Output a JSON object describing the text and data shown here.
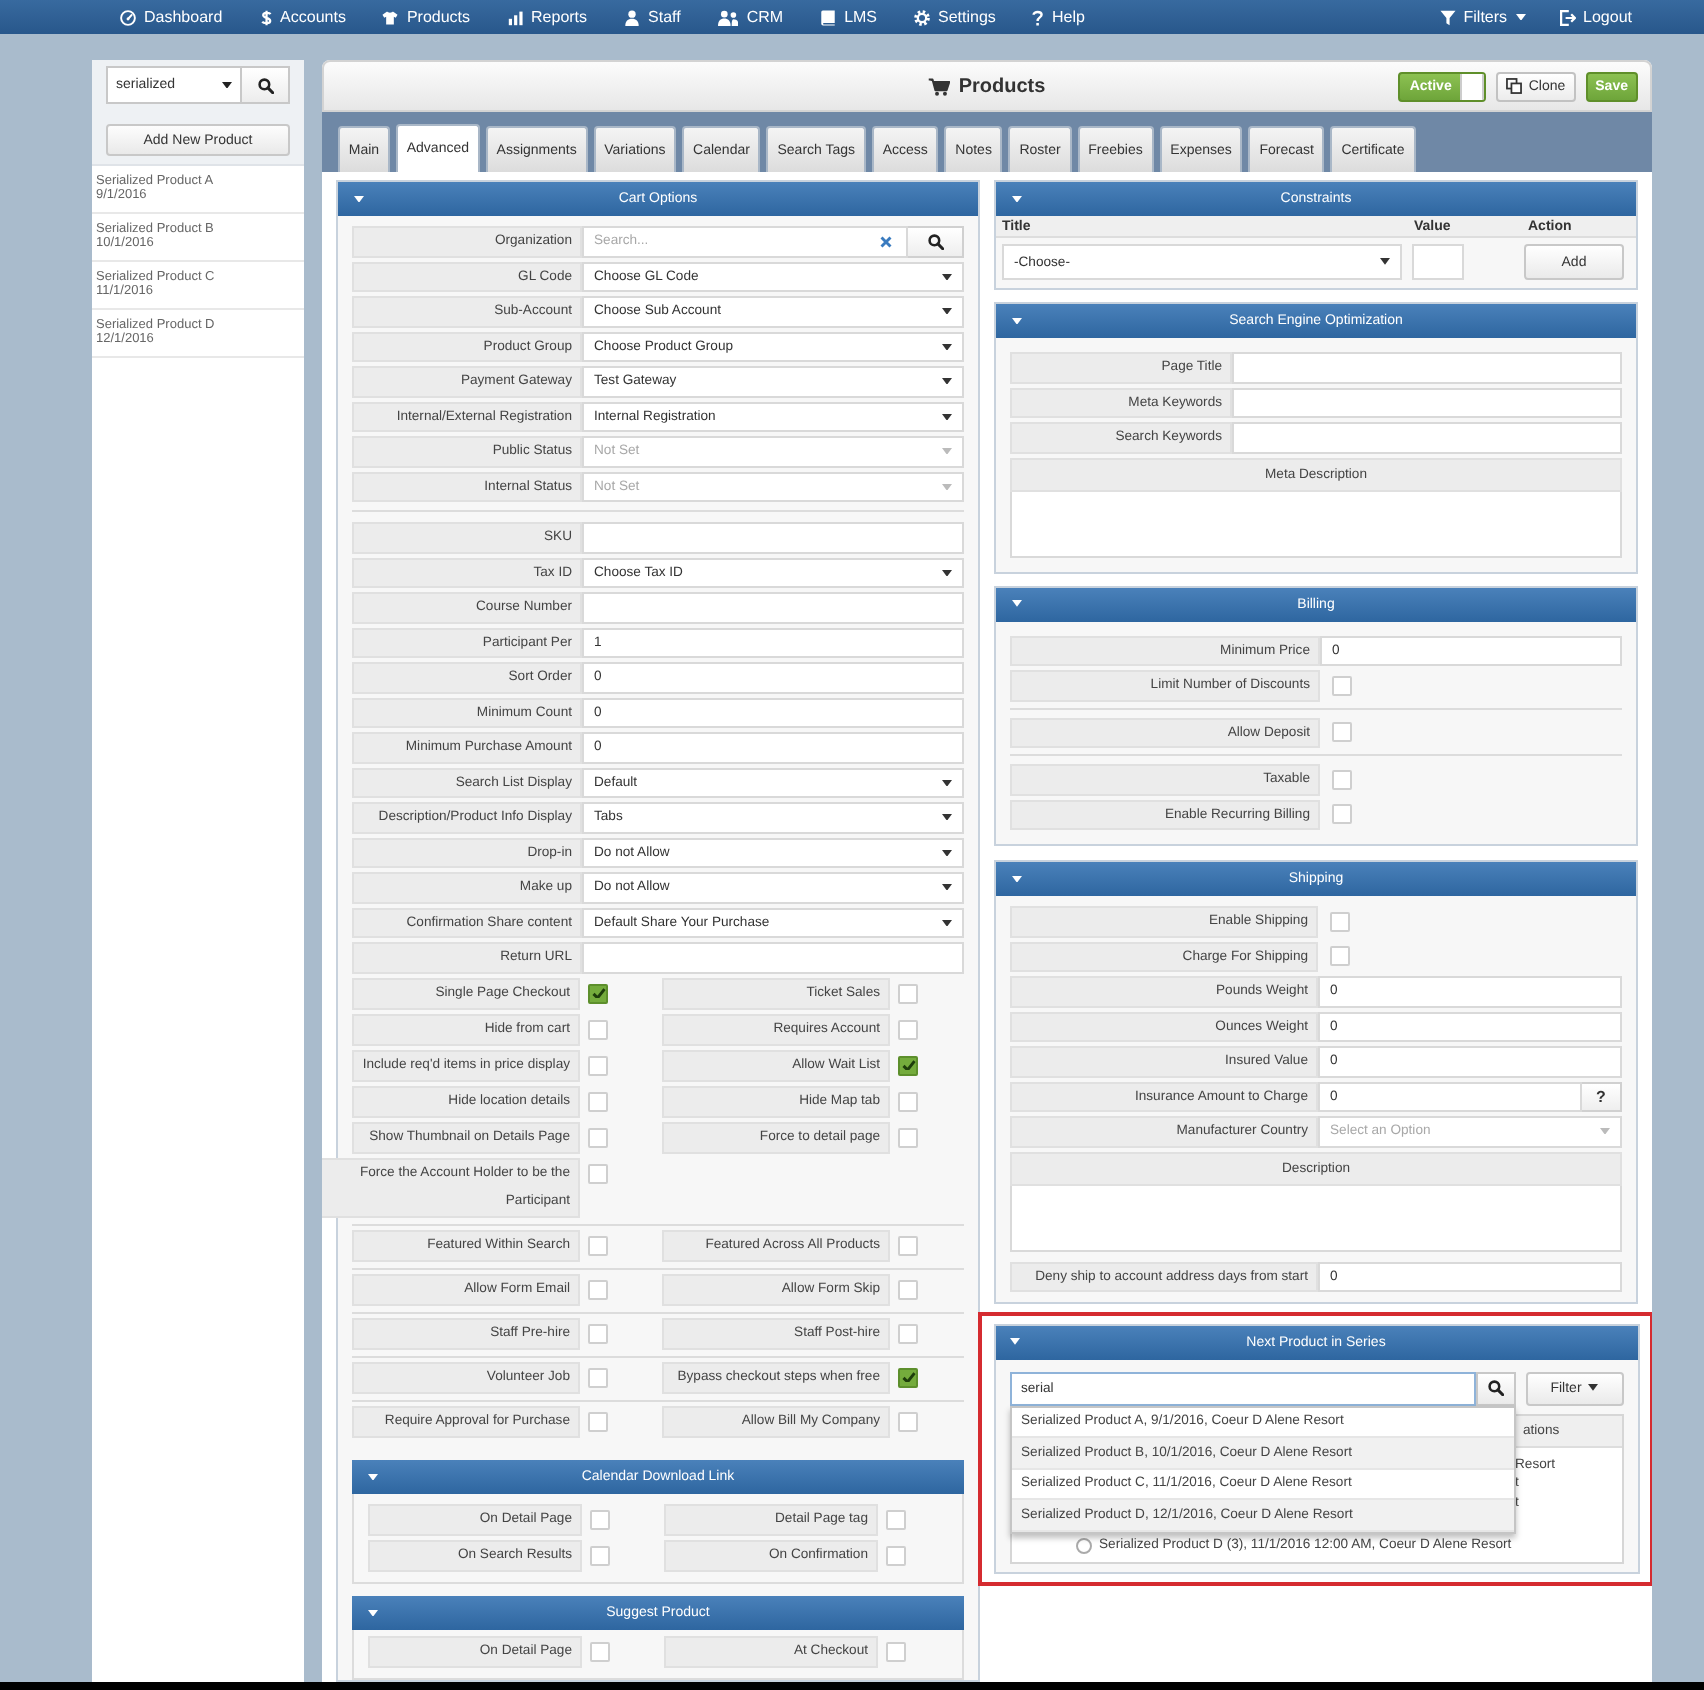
{
  "nav": {
    "items": [
      "Dashboard",
      "Accounts",
      "Products",
      "Reports",
      "Staff",
      "CRM",
      "LMS",
      "Settings",
      "Help"
    ],
    "right": [
      {
        "label": "Filters",
        "menu": true
      },
      {
        "label": "Logout",
        "menu": false
      }
    ]
  },
  "sidebar": {
    "search": {
      "value": "serialized"
    },
    "add_button": "Add New Product",
    "items": [
      {
        "name": "Serialized Product A",
        "date": "9/1/2016",
        "selected": false
      },
      {
        "name": "Serialized Product B",
        "date": "10/1/2016",
        "selected": false
      },
      {
        "name": "Serialized Product C",
        "date": "11/1/2016",
        "selected": false
      },
      {
        "name": "Serialized Product D",
        "date": "12/1/2016",
        "selected": false
      }
    ]
  },
  "header": {
    "title": "Products",
    "status": {
      "label": "Active",
      "on": true
    },
    "buttons": [
      {
        "label": "Clone",
        "kind": "secondary"
      },
      {
        "label": "Save",
        "kind": "primary"
      }
    ]
  },
  "tabs": [
    {
      "label": "Main",
      "selected": false
    },
    {
      "label": "Advanced",
      "selected": true
    },
    {
      "label": "Assignments",
      "selected": false
    },
    {
      "label": "Variations",
      "selected": false
    },
    {
      "label": "Calendar",
      "selected": false
    },
    {
      "label": "Search Tags",
      "selected": false
    },
    {
      "label": "Access",
      "selected": false
    },
    {
      "label": "Notes",
      "selected": false
    },
    {
      "label": "Roster",
      "selected": false
    },
    {
      "label": "Freebies",
      "selected": false
    },
    {
      "label": "Expenses",
      "selected": false
    },
    {
      "label": "Forecast",
      "selected": false
    },
    {
      "label": "Certificate",
      "selected": false
    }
  ],
  "cart_options": {
    "title": "Cart Options",
    "groups": [
      [
        {
          "label": "Organization",
          "kind": "search",
          "placeholder": "Search..."
        },
        {
          "label": "GL Code",
          "kind": "select",
          "value": "Choose GL Code"
        },
        {
          "label": "Sub-Account",
          "kind": "select",
          "value": "Choose Sub Account"
        },
        {
          "label": "Product Group",
          "kind": "select",
          "value": "Choose Product Group"
        },
        {
          "label": "Payment Gateway",
          "kind": "select",
          "value": "Test Gateway"
        },
        {
          "label": "Internal/External Registration",
          "kind": "select",
          "value": "Internal Registration"
        },
        {
          "label": "Public Status",
          "kind": "select",
          "placeholder": "Not Set"
        },
        {
          "label": "Internal Status",
          "kind": "select",
          "placeholder": "Not Set"
        }
      ],
      [
        {
          "label": "SKU",
          "kind": "text"
        },
        {
          "label": "Tax ID",
          "kind": "select",
          "value": "Choose Tax ID"
        },
        {
          "label": "Course Number",
          "kind": "text"
        },
        {
          "label": "Participant Per",
          "kind": "text",
          "value": "1"
        },
        {
          "label": "Sort Order",
          "kind": "text",
          "value": "0"
        },
        {
          "label": "Minimum Count",
          "kind": "text",
          "value": "0"
        },
        {
          "label": "Minimum Purchase Amount",
          "kind": "text",
          "value": "0"
        },
        {
          "label": "Search List Display",
          "kind": "select",
          "value": "Default"
        },
        {
          "label": "Description/Product Info Display",
          "kind": "select",
          "value": "Tabs"
        },
        {
          "label": "Drop-in",
          "kind": "select",
          "value": "Do not Allow"
        },
        {
          "label": "Make up",
          "kind": "select",
          "value": "Do not Allow"
        },
        {
          "label": "Confirmation Share content",
          "kind": "select",
          "value": "Default Share Your Purchase"
        },
        {
          "label": "Return URL",
          "kind": "text"
        }
      ]
    ],
    "checkbox_groups": [
      [
        [
          {
            "label": "Single Page Checkout",
            "checked": true
          },
          {
            "label": "Ticket Sales",
            "checked": false
          }
        ],
        [
          {
            "label": "Hide from cart",
            "checked": false
          },
          {
            "label": "Requires Account",
            "checked": false
          }
        ],
        [
          {
            "label": "Include req'd items in price display",
            "checked": false
          },
          {
            "label": "Allow Wait List",
            "checked": true
          }
        ],
        [
          {
            "label": "Hide location details",
            "checked": false
          },
          {
            "label": "Hide Map tab",
            "checked": false
          }
        ],
        [
          {
            "label": "Show Thumbnail on Details Page",
            "checked": false
          },
          {
            "label": "Force to detail page",
            "checked": false
          }
        ],
        [
          {
            "label": "Force the Account Holder to be the Participant",
            "checked": false
          }
        ]
      ],
      [
        [
          {
            "label": "Featured Within Search",
            "checked": false
          },
          {
            "label": "Featured Across All Products",
            "checked": false
          }
        ]
      ],
      [
        [
          {
            "label": "Allow Form Email",
            "checked": false
          },
          {
            "label": "Allow Form Skip",
            "checked": false
          }
        ]
      ],
      [
        [
          {
            "label": "Staff Pre-hire",
            "checked": false
          },
          {
            "label": "Staff Post-hire",
            "checked": false
          }
        ]
      ],
      [
        [
          {
            "label": "Volunteer Job",
            "checked": false
          },
          {
            "label": "Bypass checkout steps when free",
            "checked": true
          }
        ]
      ],
      [
        [
          {
            "label": "Require Approval for Purchase",
            "checked": false
          },
          {
            "label": "Allow Bill My Company",
            "checked": false
          }
        ]
      ]
    ],
    "subsections": [
      {
        "title": "Calendar Download Link",
        "rows": [
          [
            {
              "label": "On Detail Page",
              "checked": false
            },
            {
              "label": "Detail Page tag",
              "checked": false
            }
          ],
          [
            {
              "label": "On Search Results",
              "checked": false
            },
            {
              "label": "On Confirmation",
              "checked": false
            }
          ]
        ]
      },
      {
        "title": "Suggest Product",
        "rows": [
          [
            {
              "label": "On Detail Page",
              "checked": false
            },
            {
              "label": "At Checkout",
              "checked": false
            }
          ]
        ]
      }
    ]
  },
  "constraints": {
    "title": "Constraints",
    "columns": [
      "Title",
      "Value",
      "Action"
    ],
    "select": {
      "value": "-Choose-"
    },
    "button": "Add"
  },
  "seo": {
    "title": "Search Engine Optimization",
    "fields": [
      {
        "label": "Page Title",
        "kind": "text"
      },
      {
        "label": "Meta Keywords",
        "kind": "text"
      },
      {
        "label": "Search Keywords",
        "kind": "text"
      }
    ],
    "textarea": {
      "label": "Meta Description"
    }
  },
  "billing": {
    "title": "Billing",
    "groups": [
      [
        {
          "label": "Minimum Price",
          "kind": "text",
          "value": "0"
        },
        {
          "label": "Limit Number of Discounts",
          "kind": "checkbox",
          "checked": false
        }
      ],
      [
        {
          "label": "Allow Deposit",
          "kind": "checkbox",
          "checked": false
        }
      ],
      [
        {
          "label": "Taxable",
          "kind": "checkbox",
          "checked": false
        },
        {
          "label": "Enable Recurring Billing",
          "kind": "checkbox",
          "checked": false
        }
      ]
    ]
  },
  "shipping": {
    "title": "Shipping",
    "fields": [
      {
        "label": "Enable Shipping",
        "kind": "checkbox",
        "checked": false
      },
      {
        "label": "Charge For Shipping",
        "kind": "checkbox",
        "checked": false
      },
      {
        "label": "Pounds Weight",
        "kind": "text",
        "value": "0"
      },
      {
        "label": "Ounces Weight",
        "kind": "text",
        "value": "0"
      },
      {
        "label": "Insured Value",
        "kind": "text",
        "value": "0"
      },
      {
        "label": "Insurance Amount to Charge",
        "kind": "text",
        "value": "0",
        "help": "?"
      },
      {
        "label": "Manufacturer Country",
        "kind": "select",
        "placeholder": "Select an Option"
      }
    ],
    "textarea": {
      "label": "Description"
    },
    "after": [
      {
        "label": "Deny ship to account address days from start",
        "kind": "text",
        "value": "0"
      }
    ]
  },
  "next_product": {
    "title": "Next Product in Series",
    "highlighted": true,
    "search": {
      "value": "serial"
    },
    "filter_button": "Filter",
    "suggestions": [
      "Serialized Product A, 9/1/2016, Coeur D Alene Resort",
      "Serialized Product B, 10/1/2016, Coeur D Alene Resort",
      "Serialized Product C, 11/1/2016, Coeur D Alene Resort",
      "Serialized Product D, 12/1/2016, Coeur D Alene Resort"
    ],
    "results": {
      "header": "ations",
      "covered_rows": [
        "Resort",
        "t",
        "t"
      ],
      "options": [
        {
          "label": "Serialized Product D (3), 11/1/2016 12:00 AM, Coeur D Alene Resort",
          "selected": false
        }
      ]
    }
  }
}
